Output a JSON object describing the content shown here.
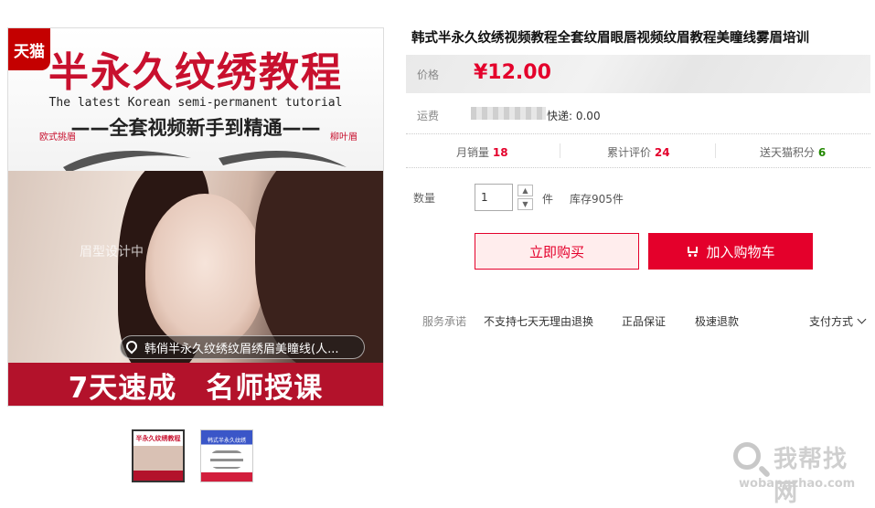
{
  "product_image": {
    "badge": "天猫",
    "title": "半永久纹绣教程",
    "subtitle_en": "The latest Korean semi-permanent tutorial",
    "subtitle_cn": "——全套视频新手到精通——",
    "brow_left_label": "欧式挑眉",
    "brow_right_label": "柳叶眉",
    "photo_watermark": "眉型设计中",
    "video_bar_text": "韩俏半永久纹绣纹眉绣眉美瞳线(人...",
    "bottom_banner": "7天速成　名师授课"
  },
  "thumbnails": [
    {
      "caption": "半永久纹绣教程"
    },
    {
      "caption": "韩式半永久纹绣"
    }
  ],
  "product": {
    "title": "韩式半永久纹绣视频教程全套纹眉眼唇视频纹眉教程美瞳线雾眉培训",
    "price_label": "价格",
    "price": "¥12.00",
    "shipping_label": "运费",
    "shipping_value": "快递: 0.00",
    "stats": {
      "monthly_sales_label": "月销量",
      "monthly_sales": "18",
      "reviews_label": "累计评价",
      "reviews": "24",
      "points_label": "送天猫积分",
      "points": "6"
    },
    "quantity_label": "数量",
    "quantity_value": "1",
    "quantity_unit": "件",
    "stock": "库存905件",
    "buy_now": "立即购买",
    "add_to_cart": "加入购物车",
    "service_label": "服务承诺",
    "services": [
      "不支持七天无理由退换",
      "正品保证",
      "极速退款"
    ],
    "payment_method": "支付方式"
  },
  "watermark": {
    "text": "我帮找网",
    "url": "wobangzhao.com"
  },
  "colors": {
    "accent": "#e4002b",
    "banner": "#b3122b",
    "points": "#228800"
  }
}
